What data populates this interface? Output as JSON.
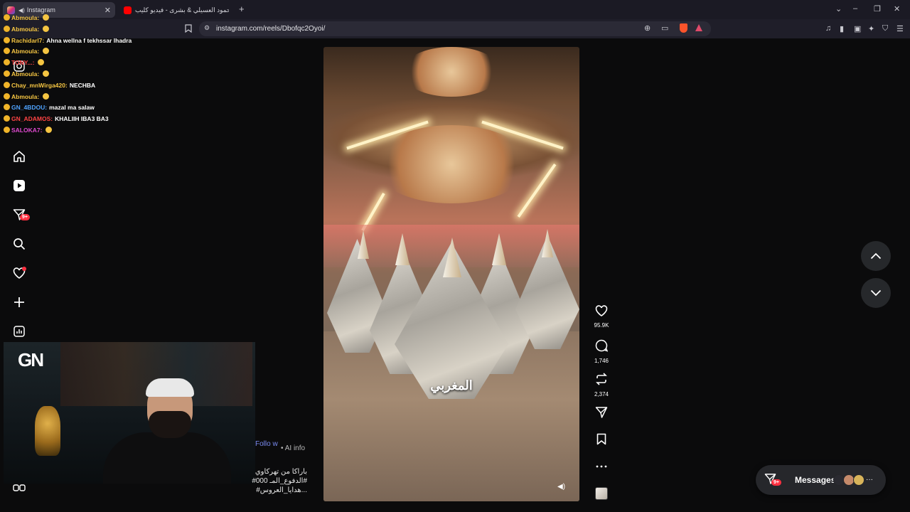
{
  "browser": {
    "tabs": [
      {
        "title": "Instagram",
        "active": true
      },
      {
        "title": "محمود العسيلي & بشرى - فيديو كليب",
        "active": false
      }
    ],
    "new_tab_label": "+",
    "url": "instagram.com/reels/Dbofqc2Oyoi/",
    "window_controls": {
      "dropdown": "⌄",
      "minimize": "–",
      "restore": "❐",
      "close": "✕"
    }
  },
  "chat": [
    {
      "user": "Abmoula:",
      "text": "",
      "user_color": "#f5c542"
    },
    {
      "user": "Abmoula:",
      "text": "",
      "user_color": "#f5c542"
    },
    {
      "user": "Rachidarl7:",
      "text": "Ahna wellna f tekhssar lhadra",
      "user_color": "#f5c542"
    },
    {
      "user": "Abmoula:",
      "text": "",
      "user_color": "#f5c542"
    },
    {
      "user": "TONY...:",
      "text": "",
      "user_color": "#ff4444"
    },
    {
      "user": "Abmoula:",
      "text": "",
      "user_color": "#f5c542"
    },
    {
      "user": "Chay_mnWirga420:",
      "text": "NECHBA",
      "user_color": "#f5c542"
    },
    {
      "user": "Abmoula:",
      "text": "",
      "user_color": "#f5c542"
    },
    {
      "user": "GN_4BDOU:",
      "text": "mazal ma salaw",
      "user_color": "#4fa3ff"
    },
    {
      "user": "GN_ADAMOS:",
      "text": "KHALIIH IBA3 BA3",
      "user_color": "#ff4444"
    },
    {
      "user": "SALOKA7:",
      "text": "",
      "user_color": "#e04ad0"
    }
  ],
  "nav": {
    "badge": "9+",
    "icons": [
      "instagram-icon",
      "home-icon",
      "reels-icon",
      "direct-icon",
      "search-icon",
      "heart-icon",
      "create-icon",
      "dashboard-icon",
      "more-icon"
    ]
  },
  "webcam": {
    "logo": "GN"
  },
  "reel": {
    "caption_overlay": "المغربي",
    "follow_label": "Follo w",
    "ai_info": "• AI info",
    "description_lines": [
      "باراكا من تهركاوي",
      "#الدفوع_المـ 000#",
      "#هدايا_العروس..."
    ]
  },
  "actions": {
    "likes": "95.9K",
    "comments": "1,746",
    "reposts": "2,374"
  },
  "messages": {
    "label": "Messages",
    "badge": "9+",
    "more": "···"
  },
  "colors": {
    "accent": "#7b8cf3",
    "badge": "#ff3040",
    "bg": "#0b0b0c"
  }
}
